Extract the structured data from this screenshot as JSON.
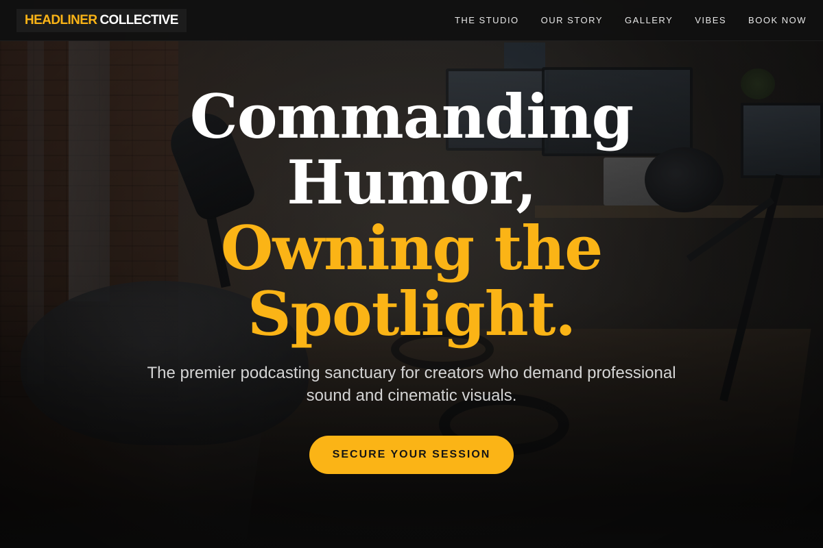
{
  "brand": {
    "logo_accent": "HEADLINER",
    "logo_main": "COLLECTIVE",
    "accent_color": "#fbb416"
  },
  "nav": {
    "links": [
      {
        "label": "THE STUDIO"
      },
      {
        "label": "OUR STORY"
      },
      {
        "label": "GALLERY"
      },
      {
        "label": "VIBES"
      },
      {
        "label": "BOOK NOW"
      }
    ]
  },
  "hero": {
    "headline_line_1": "Commanding",
    "headline_line_2": "Humor,",
    "headline_line_3": "Owning the",
    "headline_line_4": "Spotlight.",
    "subtitle": "The premier podcasting sanctuary for creators who demand professional sound and cinematic visuals.",
    "cta_label": "SECURE YOUR SESSION",
    "background": "podcast studio with microphones, headphones, monitors and brick wall"
  }
}
